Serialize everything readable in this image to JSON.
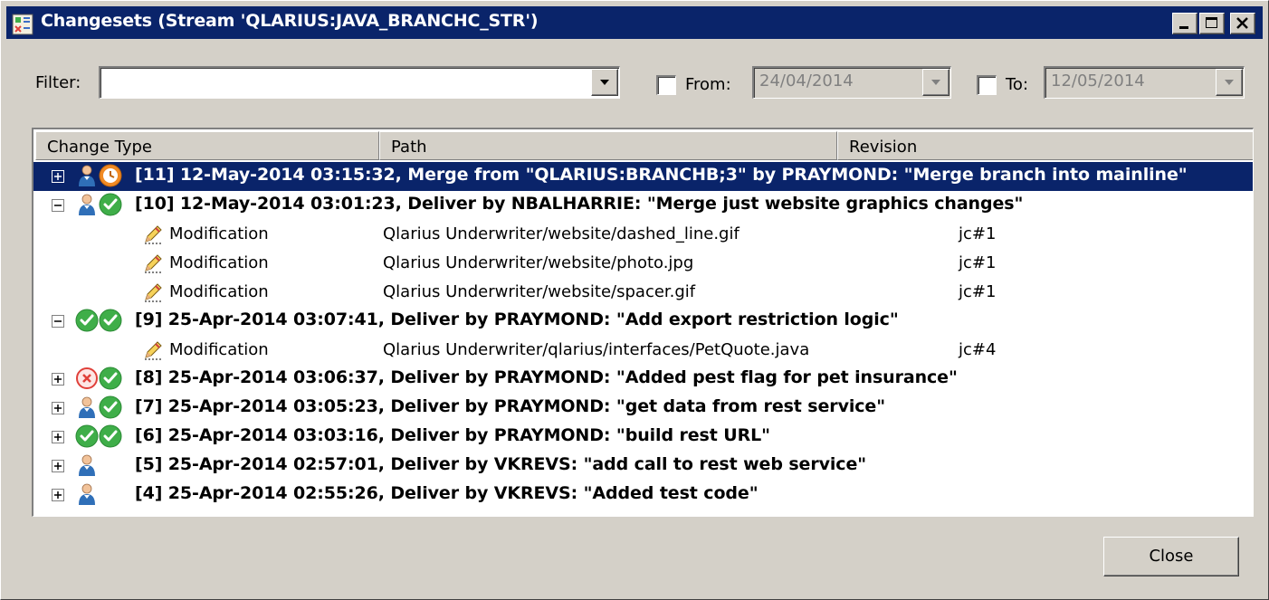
{
  "window": {
    "title": "Changesets (Stream 'QLARIUS:JAVA_BRANCHC_STR')"
  },
  "filter": {
    "label": "Filter:",
    "value": "",
    "from_label": "From:",
    "from_checked": false,
    "from_date": "24/04/2014",
    "to_label": "To:",
    "to_checked": false,
    "to_date": "12/05/2014"
  },
  "columns": {
    "change_type": "Change Type",
    "path": "Path",
    "revision": "Revision"
  },
  "rows": [
    {
      "kind": "changeset",
      "expanded": false,
      "selected": true,
      "icons": [
        "user-icon",
        "clock-icon"
      ],
      "text": "[11] 12-May-2014 03:15:32, Merge from \"QLARIUS:BRANCHB;3\" by PRAYMOND: \"Merge branch into mainline\""
    },
    {
      "kind": "changeset",
      "expanded": true,
      "selected": false,
      "icons": [
        "user-icon",
        "check-icon"
      ],
      "text": "[10] 12-May-2014 03:01:23, Deliver by NBALHARRIE: \"Merge just website graphics changes\""
    },
    {
      "kind": "change",
      "change_type": "Modification",
      "path": "Qlarius Underwriter/website/dashed_line.gif",
      "revision": "jc#1"
    },
    {
      "kind": "change",
      "change_type": "Modification",
      "path": "Qlarius Underwriter/website/photo.jpg",
      "revision": "jc#1"
    },
    {
      "kind": "change",
      "change_type": "Modification",
      "path": "Qlarius Underwriter/website/spacer.gif",
      "revision": "jc#1"
    },
    {
      "kind": "changeset",
      "expanded": true,
      "selected": false,
      "icons": [
        "check-icon",
        "check-icon"
      ],
      "text": "[9] 25-Apr-2014 03:07:41, Deliver by PRAYMOND: \"Add export restriction logic\""
    },
    {
      "kind": "change",
      "change_type": "Modification",
      "path": "Qlarius Underwriter/qlarius/interfaces/PetQuote.java",
      "revision": "jc#4"
    },
    {
      "kind": "changeset",
      "expanded": false,
      "selected": false,
      "icons": [
        "error-icon",
        "check-icon"
      ],
      "text": "[8] 25-Apr-2014 03:06:37, Deliver by PRAYMOND: \"Added pest flag for pet insurance\""
    },
    {
      "kind": "changeset",
      "expanded": false,
      "selected": false,
      "icons": [
        "user-icon",
        "check-icon"
      ],
      "text": "[7] 25-Apr-2014 03:05:23, Deliver by PRAYMOND: \"get data from rest service\""
    },
    {
      "kind": "changeset",
      "expanded": false,
      "selected": false,
      "icons": [
        "check-icon",
        "check-icon"
      ],
      "text": "[6] 25-Apr-2014 03:03:16, Deliver by PRAYMOND: \"build rest URL\""
    },
    {
      "kind": "changeset",
      "expanded": false,
      "selected": false,
      "icons": [
        "user-icon"
      ],
      "text": "[5] 25-Apr-2014 02:57:01, Deliver by VKREVS: \"add call to rest web service\""
    },
    {
      "kind": "changeset",
      "expanded": false,
      "selected": false,
      "icons": [
        "user-icon"
      ],
      "text": "[4] 25-Apr-2014 02:55:26, Deliver by VKREVS: \"Added test code\""
    }
  ],
  "buttons": {
    "close": "Close"
  },
  "colors": {
    "title_bar": "#0a246a",
    "dialog_bg": "#d4d0c8",
    "selection": "#0a246a",
    "check_green": "#3fae49",
    "error_red": "#e0403a",
    "clock_orange": "#f08a24"
  }
}
